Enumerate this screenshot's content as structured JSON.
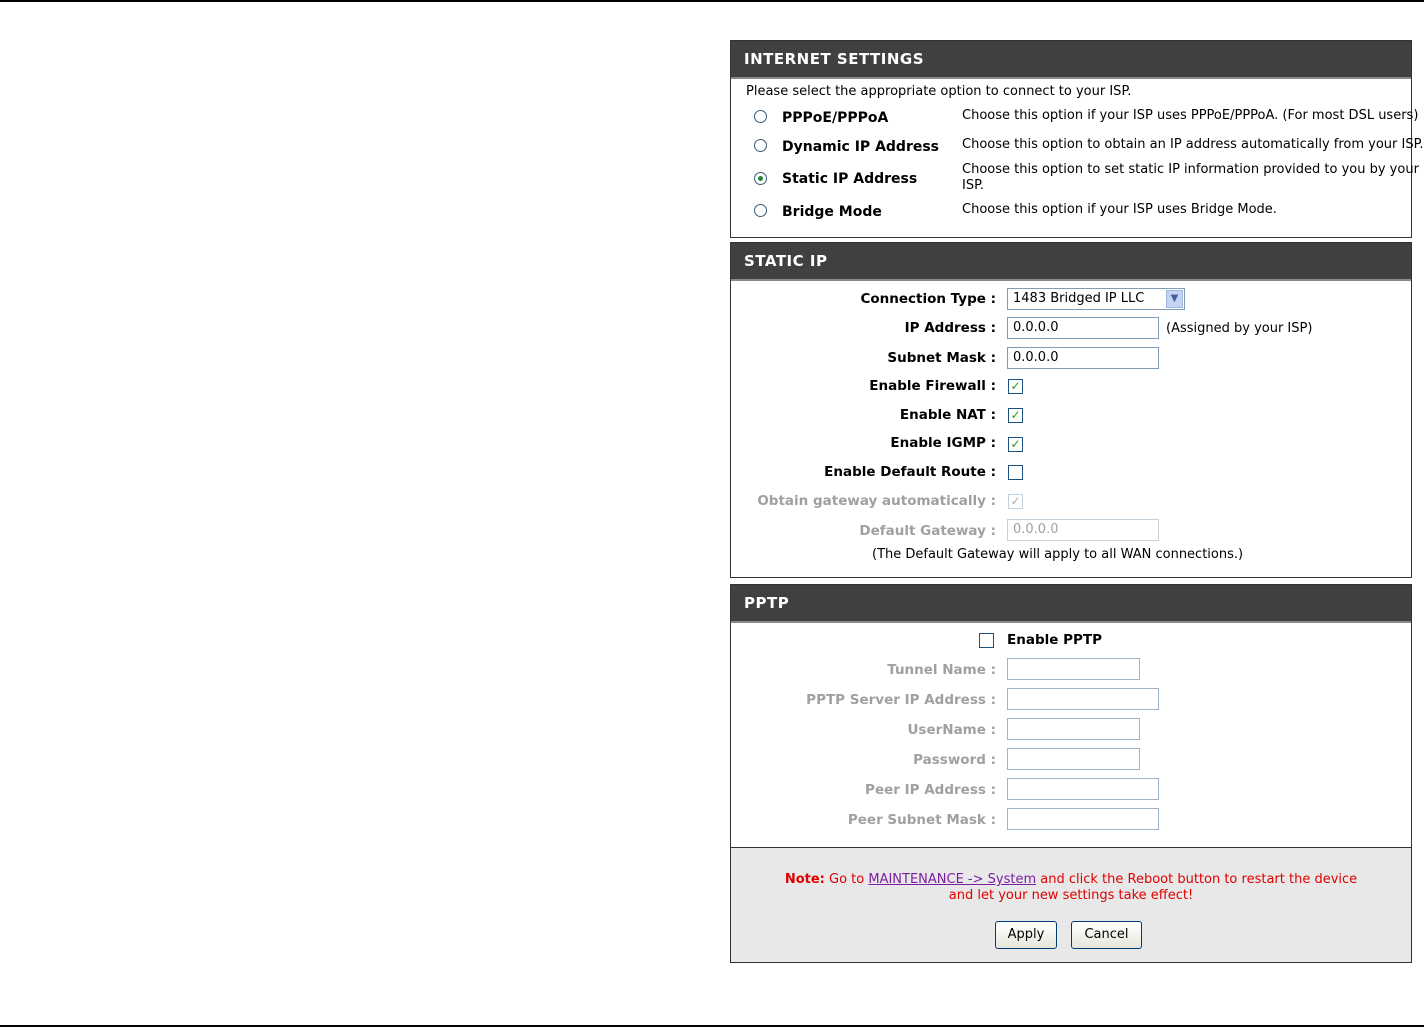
{
  "internet_settings": {
    "title": "INTERNET SETTINGS",
    "instruction": "Please select the appropriate option to connect to your ISP.",
    "options": [
      {
        "label": "PPPoE/PPPoA",
        "desc": "Choose this option if your ISP uses PPPoE/PPPoA. (For most DSL users)",
        "checked": false
      },
      {
        "label": "Dynamic IP Address",
        "desc": "Choose this option to obtain an IP address automatically from your ISP.",
        "checked": false
      },
      {
        "label": "Static IP Address",
        "desc1": "Choose this option to set static IP information provided to you by your",
        "desc2": "ISP.",
        "checked": true
      },
      {
        "label": "Bridge Mode",
        "desc": "Choose this option if your ISP uses Bridge Mode.",
        "checked": false
      }
    ]
  },
  "static_ip": {
    "title": "STATIC IP",
    "connection_type_label": "Connection Type :",
    "connection_type_value": "1483 Bridged IP LLC",
    "ip_address_label": "IP Address :",
    "ip_address_value": "0.0.0.0",
    "ip_hint": "(Assigned by your ISP)",
    "subnet_mask_label": "Subnet Mask :",
    "subnet_mask_value": "0.0.0.0",
    "firewall_label": "Enable Firewall :",
    "firewall_checked": true,
    "nat_label": "Enable NAT :",
    "nat_checked": true,
    "igmp_label": "Enable IGMP :",
    "igmp_checked": true,
    "default_route_label": "Enable Default Route :",
    "default_route_checked": false,
    "obtain_gateway_label": "Obtain gateway automatically :",
    "obtain_gateway_checked": true,
    "default_gateway_label": "Default Gateway :",
    "default_gateway_value": "0.0.0.0",
    "gateway_note": "(The Default Gateway will apply to all WAN connections.)"
  },
  "pptp": {
    "title": "PPTP",
    "enable_label": "Enable PPTP",
    "enable_checked": false,
    "tunnel_name_label": "Tunnel Name :",
    "server_ip_label": "PPTP Server IP Address :",
    "username_label": "UserName :",
    "password_label": "Password :",
    "peer_ip_label": "Peer IP Address :",
    "peer_subnet_label": "Peer Subnet Mask :"
  },
  "note": {
    "prefix": "Note:",
    "text1": " Go to ",
    "link": "MAINTENANCE -> System",
    "text2": " and click the Reboot button to restart the device",
    "line2": "and let your new settings take effect!"
  },
  "buttons": {
    "apply": "Apply",
    "cancel": "Cancel"
  }
}
